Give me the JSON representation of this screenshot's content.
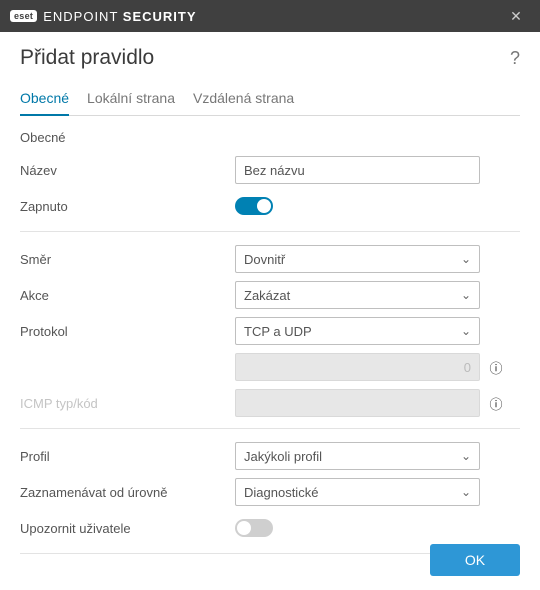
{
  "brand": {
    "badge": "eset",
    "title_light": "ENDPOINT",
    "title_bold": "SECURITY"
  },
  "dialog": {
    "title": "Přidat pravidlo"
  },
  "tabs": [
    {
      "label": "Obecné"
    },
    {
      "label": "Lokální strana"
    },
    {
      "label": "Vzdálená strana"
    }
  ],
  "section": {
    "general": "Obecné"
  },
  "fields": {
    "name_label": "Název",
    "name_value": "Bez názvu",
    "enabled_label": "Zapnuto",
    "direction_label": "Směr",
    "direction_value": "Dovnitř",
    "action_label": "Akce",
    "action_value": "Zakázat",
    "protocol_label": "Protokol",
    "protocol_value": "TCP a UDP",
    "proto_num_value": "0",
    "icmp_label": "ICMP typ/kód",
    "icmp_value": "",
    "profile_label": "Profil",
    "profile_value": "Jakýkoli profil",
    "log_label": "Zaznamenávat od úrovně",
    "log_value": "Diagnostické",
    "notify_label": "Upozornit uživatele"
  },
  "footer": {
    "ok": "OK"
  }
}
